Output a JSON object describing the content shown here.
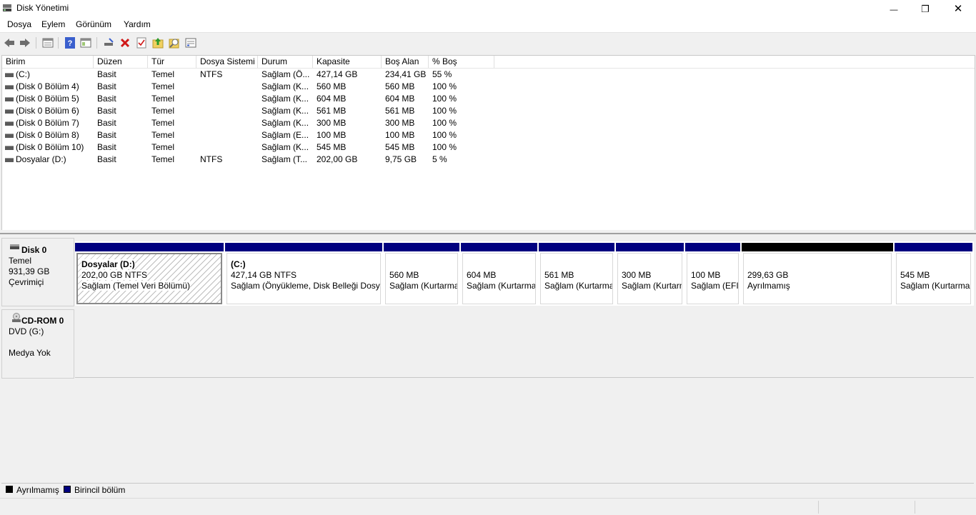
{
  "window": {
    "title": "Disk Yönetimi",
    "minimize_glyph": "—",
    "maximize_glyph": "❐",
    "close_glyph": "✕"
  },
  "menu": {
    "items": [
      "Dosya",
      "Eylem",
      "Görünüm",
      "Yardım"
    ]
  },
  "toolbar": {
    "buttons": [
      "back-arrow-icon",
      "forward-arrow-icon",
      "disk-list-icon",
      "help-icon",
      "console-tree-icon",
      "connect-drive-icon",
      "delete-icon",
      "check-icon",
      "export-icon",
      "properties-icon",
      "view-icon"
    ]
  },
  "volumes": {
    "columns": [
      "Birim",
      "Düzen",
      "Tür",
      "Dosya Sistemi",
      "Durum",
      "Kapasite",
      "Boş Alan",
      "% Boş"
    ],
    "rows": [
      [
        " (C:)",
        "Basit",
        "Temel",
        "NTFS",
        "Sağlam (Ö...",
        "427,14 GB",
        "234,41 GB",
        "55 %"
      ],
      [
        "(Disk 0 Bölüm 4)",
        "Basit",
        "Temel",
        "",
        "Sağlam (K...",
        "560 MB",
        "560 MB",
        "100 %"
      ],
      [
        "(Disk 0 Bölüm 5)",
        "Basit",
        "Temel",
        "",
        "Sağlam (K...",
        "604 MB",
        "604 MB",
        "100 %"
      ],
      [
        "(Disk 0 Bölüm 6)",
        "Basit",
        "Temel",
        "",
        "Sağlam (K...",
        "561 MB",
        "561 MB",
        "100 %"
      ],
      [
        "(Disk 0 Bölüm 7)",
        "Basit",
        "Temel",
        "",
        "Sağlam (K...",
        "300 MB",
        "300 MB",
        "100 %"
      ],
      [
        "(Disk 0 Bölüm 8)",
        "Basit",
        "Temel",
        "",
        "Sağlam (E...",
        "100 MB",
        "100 MB",
        "100 %"
      ],
      [
        "(Disk 0 Bölüm 10)",
        "Basit",
        "Temel",
        "",
        "Sağlam (K...",
        "545 MB",
        "545 MB",
        "100 %"
      ],
      [
        "Dosyalar (D:)",
        "Basit",
        "Temel",
        "NTFS",
        "Sağlam (T...",
        "202,00 GB",
        "9,75 GB",
        "5 %"
      ]
    ]
  },
  "disk0": {
    "name": "Disk 0",
    "type": "Temel",
    "size": "931,39 GB",
    "status": "Çevrimiçi",
    "partitions": [
      {
        "name": "Dosyalar  (D:)",
        "size": "202,00 GB NTFS",
        "status": "Sağlam (Temel Veri Bölümü)",
        "kind": "primary"
      },
      {
        "name": " (C:)",
        "size": "427,14 GB NTFS",
        "status": "Sağlam (Önyükleme, Disk Belleği Dosyası)",
        "kind": "primary"
      },
      {
        "name": "",
        "size": "560 MB",
        "status": "Sağlam (Kurtarma Bölümü)",
        "kind": "primary"
      },
      {
        "name": "",
        "size": "604 MB",
        "status": "Sağlam (Kurtarma Bölümü)",
        "kind": "primary"
      },
      {
        "name": "",
        "size": "561 MB",
        "status": "Sağlam (Kurtarma Bölümü)",
        "kind": "primary"
      },
      {
        "name": "",
        "size": "300 MB",
        "status": "Sağlam (Kurtarma Bölümü)",
        "kind": "primary"
      },
      {
        "name": "",
        "size": "100 MB",
        "status": "Sağlam (EFI Sistem Bölümü)",
        "kind": "primary"
      },
      {
        "name": "",
        "size": "299,63 GB",
        "status": "Ayrılmamış",
        "kind": "unallocated"
      },
      {
        "name": "",
        "size": "545 MB",
        "status": "Sağlam (Kurtarma Bölümü)",
        "kind": "primary"
      }
    ]
  },
  "cdrom0": {
    "name": "CD-ROM 0",
    "drive": "DVD (G:)",
    "status": "Medya Yok"
  },
  "legend": {
    "unallocated": "Ayrılmamış",
    "primary": "Birincil bölüm"
  },
  "colors": {
    "primary_bar": "#000080",
    "unallocated_bar": "#000000",
    "selection_border": "#8a8a8a"
  }
}
